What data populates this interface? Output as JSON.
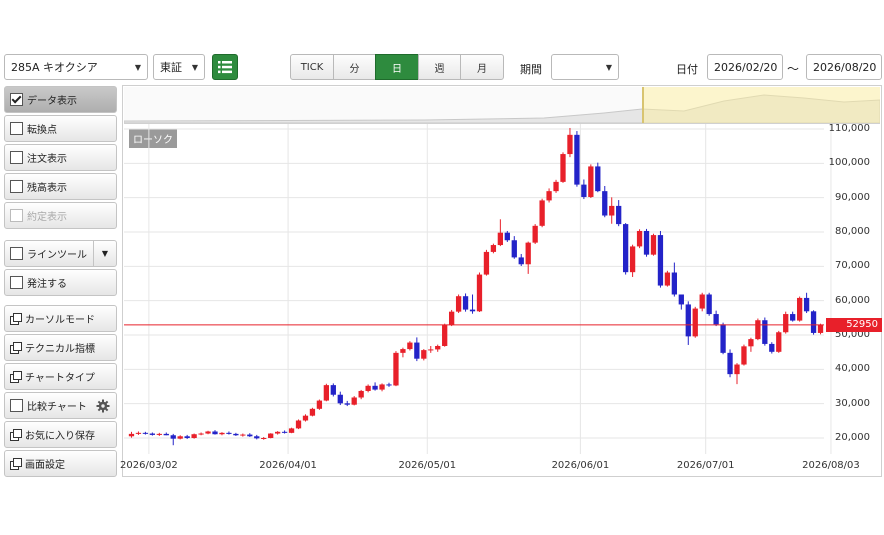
{
  "toolbar": {
    "symbol_value": "285A キオクシア",
    "market_value": "東証",
    "intervals": [
      {
        "label": "TICK",
        "active": false
      },
      {
        "label": "分",
        "active": false
      },
      {
        "label": "日",
        "active": true
      },
      {
        "label": "週",
        "active": false
      },
      {
        "label": "月",
        "active": false
      }
    ],
    "period_label": "期間",
    "period_value": "",
    "date_label": "日付",
    "date_from": "2026/02/20",
    "date_sep": "～",
    "date_to": "2026/08/20",
    "list_icon": "list-icon"
  },
  "sidebar": {
    "items": [
      {
        "label": "データ表示",
        "kind": "checkbox",
        "checked": true,
        "selected": true
      },
      {
        "label": "転換点",
        "kind": "checkbox",
        "checked": false
      },
      {
        "label": "注文表示",
        "kind": "checkbox",
        "checked": false
      },
      {
        "label": "残高表示",
        "kind": "checkbox",
        "checked": false
      },
      {
        "label": "約定表示",
        "kind": "checkbox",
        "checked": false,
        "disabled": true
      },
      {
        "label": "ラインツール",
        "kind": "checkbox",
        "checked": false
      },
      {
        "label": "発注する",
        "kind": "checkbox",
        "checked": false
      },
      {
        "label": "カーソルモード",
        "kind": "window"
      },
      {
        "label": "テクニカル指標",
        "kind": "window"
      },
      {
        "label": "チャートタイプ",
        "kind": "window"
      },
      {
        "label": "比較チャート",
        "kind": "checkbox",
        "checked": false
      },
      {
        "label": "お気に入り保存",
        "kind": "window"
      },
      {
        "label": "画面設定",
        "kind": "window"
      }
    ]
  },
  "chart": {
    "type_label": "ローソク",
    "price_tag": "52950",
    "colors": {
      "up": "#e8202a",
      "down": "#2323c8",
      "price_line": "#e8202a",
      "navigator_highlight": "#fff8cc"
    }
  },
  "chart_data": {
    "type": "candlestick",
    "y_ticks": [
      "110,000",
      "100,000",
      "90,000",
      "80,000",
      "70,000",
      "60,000",
      "50,000",
      "40,000",
      "30,000",
      "20,000"
    ],
    "x_ticks": [
      "2026/03/02",
      "2026/04/01",
      "2026/05/01",
      "2026/06/01",
      "2026/07/01",
      "2026/08/03"
    ],
    "y_range": [
      17000,
      112000
    ],
    "last_price": 52950,
    "candles": [
      [
        20500,
        21800,
        20100,
        21200
      ],
      [
        21200,
        21900,
        20900,
        21500
      ],
      [
        21500,
        21800,
        21000,
        21300
      ],
      [
        21300,
        21600,
        20700,
        20900
      ],
      [
        20900,
        21500,
        20600,
        21200
      ],
      [
        21200,
        21600,
        20800,
        20800
      ],
      [
        20800,
        21200,
        17900,
        19800
      ],
      [
        19800,
        20800,
        19600,
        20500
      ],
      [
        20500,
        20900,
        19700,
        20000
      ],
      [
        20000,
        21300,
        19800,
        21100
      ],
      [
        21100,
        21600,
        20800,
        21300
      ],
      [
        21300,
        22100,
        21100,
        21900
      ],
      [
        21900,
        22300,
        21000,
        21100
      ],
      [
        21100,
        21700,
        20800,
        21500
      ],
      [
        21500,
        21900,
        21000,
        21200
      ],
      [
        21200,
        21500,
        20600,
        20800
      ],
      [
        20800,
        21300,
        20400,
        21000
      ],
      [
        21000,
        21400,
        20300,
        20500
      ],
      [
        20500,
        20900,
        19600,
        19900
      ],
      [
        19900,
        20300,
        19500,
        20000
      ],
      [
        20000,
        21400,
        19900,
        21300
      ],
      [
        21300,
        22000,
        21000,
        21800
      ],
      [
        21800,
        22200,
        21300,
        21500
      ],
      [
        21500,
        23000,
        21400,
        22800
      ],
      [
        22800,
        25400,
        22600,
        25100
      ],
      [
        25100,
        26900,
        24800,
        26500
      ],
      [
        26500,
        28800,
        26300,
        28500
      ],
      [
        28500,
        31200,
        28200,
        30900
      ],
      [
        30900,
        35800,
        30700,
        35400
      ],
      [
        35400,
        35900,
        32100,
        32600
      ],
      [
        32600,
        33500,
        29600,
        30100
      ],
      [
        30100,
        30800,
        29300,
        29700
      ],
      [
        29700,
        32200,
        29500,
        31800
      ],
      [
        31800,
        34000,
        31300,
        33700
      ],
      [
        33700,
        35600,
        33300,
        35200
      ],
      [
        35200,
        36200,
        33800,
        34100
      ],
      [
        34100,
        35900,
        33600,
        35600
      ],
      [
        35600,
        36100,
        34900,
        35300
      ],
      [
        35300,
        45300,
        35100,
        44800
      ],
      [
        44800,
        46300,
        43500,
        45900
      ],
      [
        45900,
        48200,
        45500,
        47800
      ],
      [
        47800,
        49300,
        42400,
        43100
      ],
      [
        43100,
        45900,
        42600,
        45600
      ],
      [
        45600,
        46800,
        44800,
        45800
      ],
      [
        45800,
        47200,
        45100,
        46800
      ],
      [
        46800,
        53300,
        46600,
        52900
      ],
      [
        52900,
        57300,
        52600,
        56800
      ],
      [
        56800,
        61800,
        56400,
        61300
      ],
      [
        61300,
        62100,
        56800,
        57400
      ],
      [
        57400,
        61800,
        56200,
        56900
      ],
      [
        56900,
        68200,
        56700,
        67600
      ],
      [
        67600,
        74800,
        67300,
        74200
      ],
      [
        74200,
        76600,
        73800,
        76200
      ],
      [
        76200,
        83700,
        75900,
        79800
      ],
      [
        79800,
        80300,
        77100,
        77600
      ],
      [
        77600,
        78800,
        72200,
        72600
      ],
      [
        72600,
        73600,
        70100,
        70600
      ],
      [
        70600,
        77200,
        67800,
        76900
      ],
      [
        76900,
        82300,
        76500,
        81800
      ],
      [
        81800,
        89700,
        81400,
        89200
      ],
      [
        89200,
        92700,
        88600,
        91900
      ],
      [
        91900,
        95200,
        91400,
        94600
      ],
      [
        94600,
        103200,
        94300,
        102700
      ],
      [
        102700,
        110300,
        101800,
        108300
      ],
      [
        108300,
        109400,
        93200,
        93800
      ],
      [
        93800,
        95300,
        89600,
        90200
      ],
      [
        90200,
        99700,
        89900,
        99100
      ],
      [
        99100,
        100200,
        91600,
        91900
      ],
      [
        91900,
        93400,
        84300,
        84800
      ],
      [
        84800,
        90100,
        82400,
        87600
      ],
      [
        87600,
        89300,
        81700,
        82300
      ],
      [
        82300,
        82600,
        67600,
        68300
      ],
      [
        68300,
        76300,
        66900,
        75800
      ],
      [
        75800,
        80800,
        75300,
        80300
      ],
      [
        80300,
        80900,
        72800,
        73400
      ],
      [
        73400,
        79500,
        73100,
        79100
      ],
      [
        79100,
        80300,
        63800,
        64400
      ],
      [
        64400,
        68700,
        64100,
        68200
      ],
      [
        68200,
        71100,
        61200,
        61800
      ],
      [
        61800,
        59200,
        57400,
        58900
      ],
      [
        58900,
        59800,
        47100,
        49600
      ],
      [
        49600,
        58200,
        49200,
        57700
      ],
      [
        57700,
        62300,
        56900,
        61800
      ],
      [
        61800,
        62300,
        55600,
        56100
      ],
      [
        56100,
        57100,
        52600,
        53100
      ],
      [
        53100,
        53600,
        44400,
        44800
      ],
      [
        44800,
        45800,
        37700,
        38600
      ],
      [
        38600,
        41800,
        35700,
        41400
      ],
      [
        41400,
        47200,
        41100,
        46700
      ],
      [
        46700,
        49200,
        45100,
        48800
      ],
      [
        48800,
        54800,
        48500,
        54300
      ],
      [
        54300,
        55100,
        46900,
        47400
      ],
      [
        47400,
        47900,
        44600,
        45100
      ],
      [
        45100,
        51200,
        44800,
        50800
      ],
      [
        50800,
        56800,
        50400,
        56100
      ],
      [
        56100,
        56800,
        53900,
        54200
      ],
      [
        54200,
        61200,
        53900,
        60800
      ],
      [
        60800,
        62300,
        56400,
        56900
      ],
      [
        56900,
        57200,
        50100,
        50600
      ],
      [
        50600,
        53300,
        50200,
        52950
      ]
    ]
  }
}
